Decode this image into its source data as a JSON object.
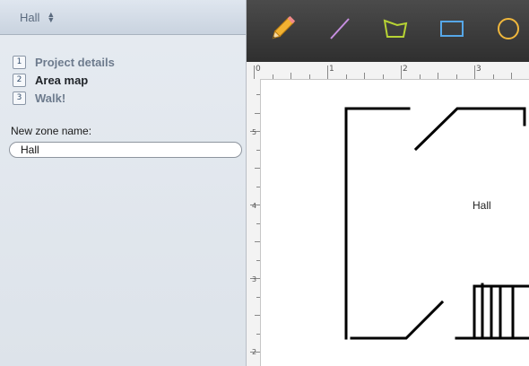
{
  "zone_selector": {
    "label": "Hall"
  },
  "steps": [
    {
      "number": "1",
      "label": "Project details"
    },
    {
      "number": "2",
      "label": "Area map"
    },
    {
      "number": "3",
      "label": "Walk!"
    }
  ],
  "zone_form": {
    "label": "New zone name:",
    "value": "Hall"
  },
  "toolbar": {
    "tools": [
      {
        "name": "pencil",
        "icon": "pencil-icon"
      },
      {
        "name": "line",
        "icon": "line-icon"
      },
      {
        "name": "polygon",
        "icon": "polygon-icon"
      },
      {
        "name": "rectangle",
        "icon": "rectangle-icon"
      },
      {
        "name": "circle",
        "icon": "circle-icon"
      }
    ]
  },
  "ruler": {
    "top_labels": [
      "0",
      "1",
      "2",
      "3"
    ],
    "left_labels": [
      "5",
      "4",
      "3",
      "2"
    ]
  },
  "canvas": {
    "zone_label": "Hall"
  },
  "colors": {
    "line_tool": "#c78fe0",
    "polygon_tool": "#b7d334",
    "rectangle_tool": "#56a7e8",
    "circle_tool": "#f0b73c"
  }
}
